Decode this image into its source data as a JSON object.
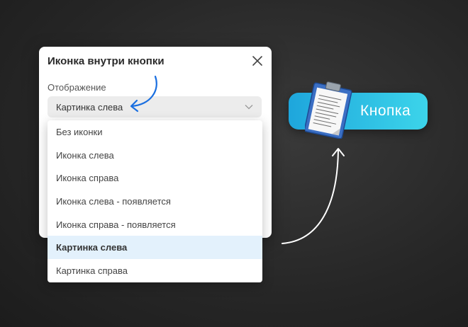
{
  "dialog": {
    "title": "Иконка внутри кнопки",
    "field_label": "Отображение",
    "select_value": "Картинка слева"
  },
  "dropdown": {
    "options": [
      {
        "label": "Без иконки",
        "selected": false
      },
      {
        "label": "Иконка слева",
        "selected": false
      },
      {
        "label": "Иконка справа",
        "selected": false
      },
      {
        "label": "Иконка слева - появляется",
        "selected": false
      },
      {
        "label": "Иконка справа - появляется",
        "selected": false
      },
      {
        "label": "Картинка слева",
        "selected": true
      },
      {
        "label": "Картинка справа",
        "selected": false
      }
    ]
  },
  "preview": {
    "button_label": "Кнопка",
    "image_icon": "clipboard-document-icon"
  },
  "colors": {
    "accent_blue": "#1a6fe0",
    "button_gradient_start": "#1ea6dc",
    "button_gradient_end": "#3cd4ea",
    "selected_option_bg": "#e3f1fc"
  }
}
